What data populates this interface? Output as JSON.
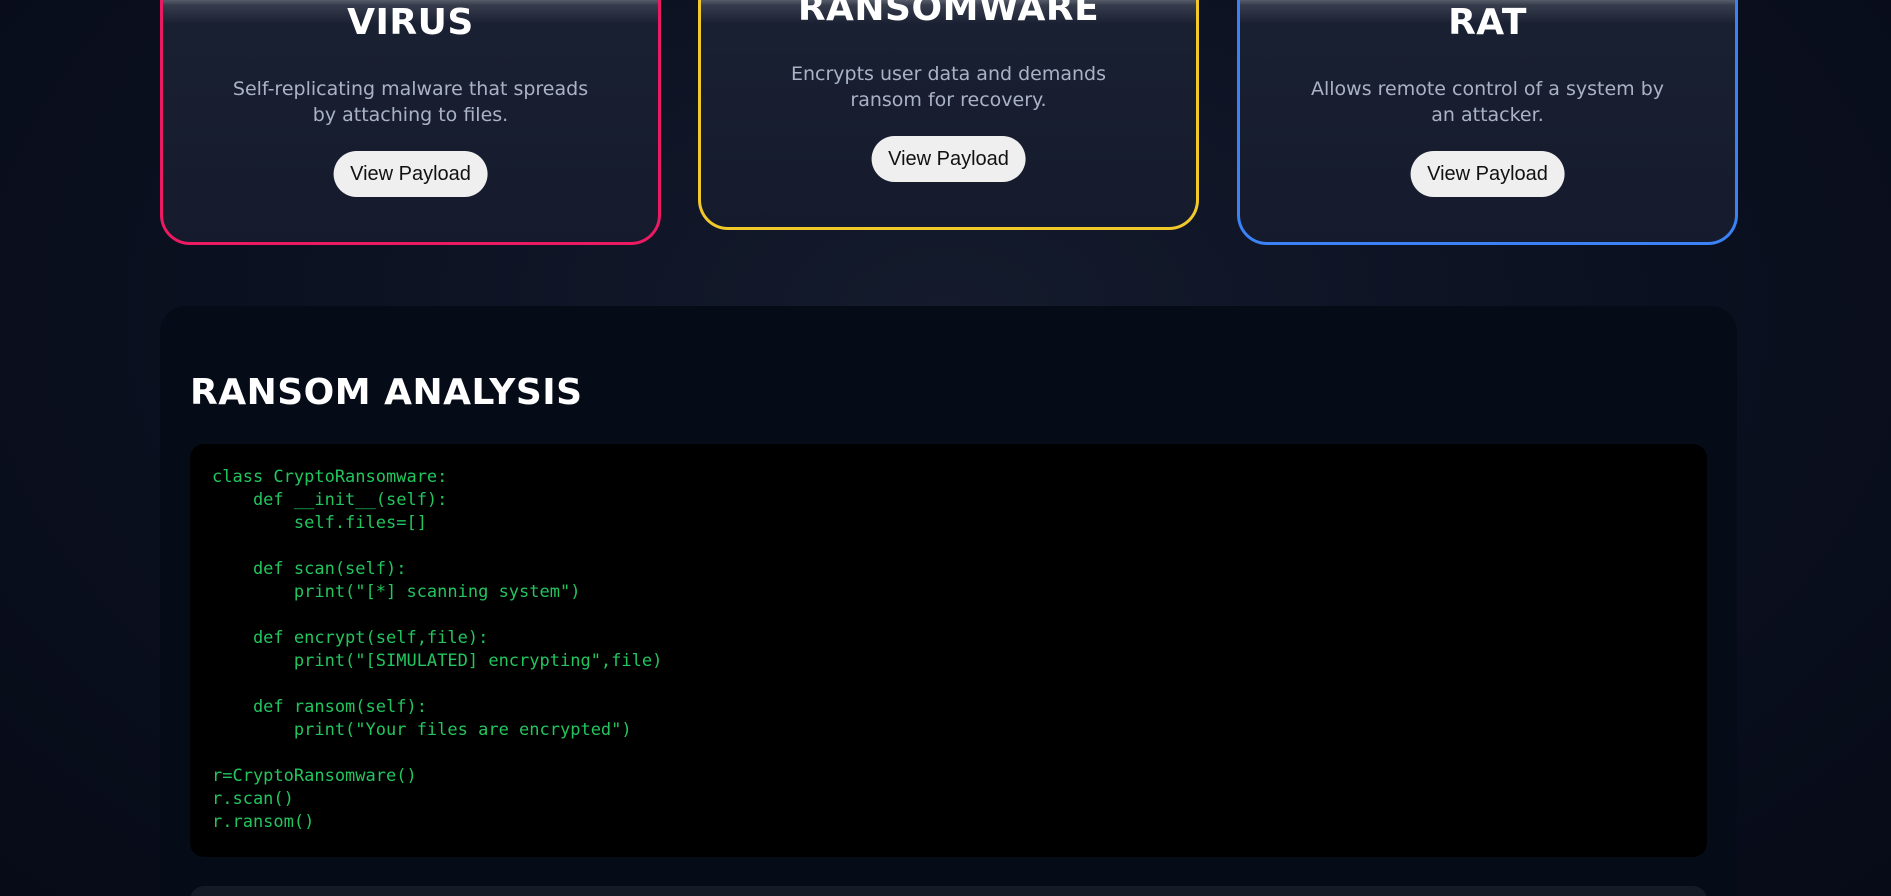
{
  "cards": [
    {
      "title": "VIRUS",
      "description": "Self-replicating malware that spreads by attaching to files.",
      "button_label": "View Payload",
      "accent_color": "#ec1a63"
    },
    {
      "title": "RANSOMWARE",
      "description": "Encrypts user data and demands ransom for recovery.",
      "button_label": "View Payload",
      "accent_color": "#f2c92b"
    },
    {
      "title": "RAT",
      "description": "Allows remote control of a system by an attacker.",
      "button_label": "View Payload",
      "accent_color": "#3b82f6"
    }
  ],
  "analysis": {
    "title": "RANSOM ANALYSIS",
    "code": "class CryptoRansomware:\n    def __init__(self):\n        self.files=[]\n\n    def scan(self):\n        print(\"[*] scanning system\")\n\n    def encrypt(self,file):\n        print(\"[SIMULATED] encrypting\",file)\n\n    def ransom(self):\n        print(\"Your files are encrypted\")\n\nr=CryptoRansomware()\nr.scan()\nr.ransom()",
    "code_color": "#22c55e"
  }
}
